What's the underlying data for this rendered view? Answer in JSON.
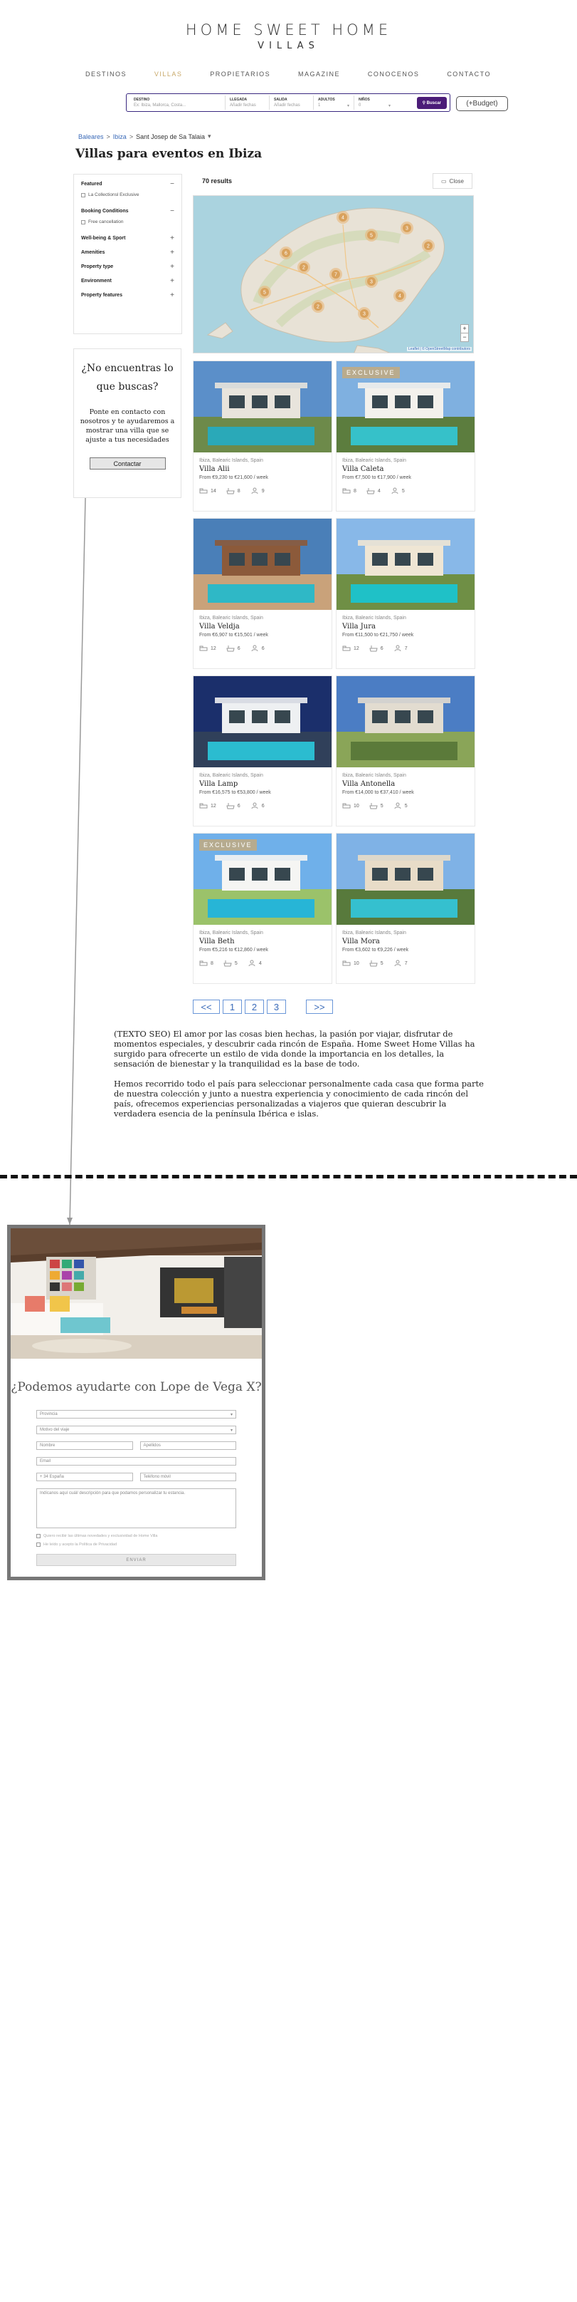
{
  "brand": {
    "title": "HOME SWEET HOME",
    "subtitle": "VILLAS"
  },
  "nav": [
    "DESTINOS",
    "VILLAS",
    "PROPIETARIOS",
    "MAGAZINE",
    "CONOCENOS",
    "CONTACTO"
  ],
  "search": {
    "destination_label": "DESTINO",
    "destination_placeholder": "Ex: Ibiza, Mallorca, Costa...",
    "from_label": "LLEGADA",
    "from_placeholder": "Añadir fechas",
    "to_label": "SALIDA",
    "to_placeholder": "Añadir fechas",
    "adults_label": "ADULTOS",
    "adults_value": "1",
    "kids_label": "NIÑOS",
    "kids_value": "0",
    "button": "Buscar",
    "budget": "(+Budget)"
  },
  "breadcrumb": {
    "items": [
      "Baleares",
      "Ibiza",
      "Sant Josep de Sa Talaia"
    ],
    "sep": ">"
  },
  "page_title": "Villas para eventos en Ibiza",
  "filters": {
    "featured": {
      "title": "Featured",
      "option": "La Collectionsl Exclusive"
    },
    "booking": {
      "title": "Booking Conditions",
      "option": "Free cancellation"
    },
    "sections": [
      "Well-being & Sport",
      "Amenities",
      "Property type",
      "Environment",
      "Property features"
    ]
  },
  "help": {
    "title": "¿No encuentras lo que buscas?",
    "text": "Ponte en contacto con nosotros y te ayudaremos a mostrar una villa que se ajuste a tus necesidades",
    "button": "Contactar"
  },
  "results": {
    "count": "70 results",
    "close": "Close"
  },
  "map": {
    "attribution": "Leaflet | © OpenStreetMap contributors",
    "zoom_in": "+",
    "zoom_out": "−",
    "markers": [
      "4",
      "5",
      "3",
      "2",
      "6",
      "2",
      "7",
      "3",
      "4",
      "5",
      "2",
      "3"
    ]
  },
  "villas": [
    {
      "loc": "Ibiza, Balearic Islands, Spain",
      "name": "Villa Alii",
      "price": "From €9,230 to €21,600 / week",
      "beds": "14",
      "baths": "8",
      "guests": "9",
      "badge": ""
    },
    {
      "loc": "Ibiza, Balearic Islands, Spain",
      "name": "Villa Caleta",
      "price": "From €7,500 to €17,900 / week",
      "beds": "8",
      "baths": "4",
      "guests": "5",
      "badge": "EXCLUSIVE"
    },
    {
      "loc": "Ibiza, Balearic Islands, Spain",
      "name": "Villa Veldja",
      "price": "From €6,907 to €15,501 / week",
      "beds": "12",
      "baths": "6",
      "guests": "6",
      "badge": ""
    },
    {
      "loc": "Ibiza, Balearic Islands, Spain",
      "name": "Villa Jura",
      "price": "From €11,500 to €21,750 / week",
      "beds": "12",
      "baths": "6",
      "guests": "7",
      "badge": ""
    },
    {
      "loc": "Ibiza, Balearic Islands, Spain",
      "name": "Villa Lamp",
      "price": "From €16,575 to €53,800 / week",
      "beds": "12",
      "baths": "6",
      "guests": "6",
      "badge": ""
    },
    {
      "loc": "Ibiza, Balearic Islands, Spain",
      "name": "Villa Antonella",
      "price": "From €14,000 to €37,410 / week",
      "beds": "10",
      "baths": "5",
      "guests": "5",
      "badge": ""
    },
    {
      "loc": "Ibiza, Balearic Islands, Spain",
      "name": "Villa Beth",
      "price": "From €5,216 to €12,860 / week",
      "beds": "8",
      "baths": "5",
      "guests": "4",
      "badge": "EXCLUSIVE"
    },
    {
      "loc": "Ibiza, Balearic Islands, Spain",
      "name": "Villa Mora",
      "price": "From €3,602 to €9,226 / week",
      "beds": "10",
      "baths": "5",
      "guests": "7",
      "badge": ""
    }
  ],
  "pager": {
    "prev": "<<",
    "pages": [
      "1",
      "2",
      "3"
    ],
    "next": ">>"
  },
  "seo": {
    "p1": "(TEXTO SEO) El amor por las cosas bien hechas, la pasión por viajar, disfrutar de momentos especiales, y descubrir cada rincón de España. Home Sweet Home Villas ha surgido para ofrecerte un estilo de vida donde la importancia en los detalles, la sensación de bienestar y la tranquilidad es la base de todo.",
    "p2": "Hemos recorrido todo el país para seleccionar personalmente cada casa que forma parte de nuestra colección y junto a nuestra experiencia y conocimiento de cada rincón del país, ofrecemos experiencias personalizadas a viajeros que quieran descubrir la verdadera esencia de la península Ibérica e islas."
  },
  "contact": {
    "title": "¿Podemos ayudarte con Lope de Vega X?",
    "select1": "Provincia",
    "select2": "Motivo del viaje",
    "name": "Nombre",
    "surname": "Apellidos",
    "email": "Email",
    "prefix": "+ 34 España",
    "phone": "Teléfono móvil",
    "message": "Indícanos aquí cuál/ descripción para que podamos personalizar tu estancia.",
    "check1": "Quiero recibir las últimas novedades y exclusividad de Home Villa",
    "check2": "He leído y acepto la Política de Privacidad",
    "send": "ENVIAR"
  },
  "colors": {
    "accent": "#c8a868",
    "search_border": "#3a2880",
    "search_button": "#4b1c78",
    "link": "#3a6ab8"
  }
}
